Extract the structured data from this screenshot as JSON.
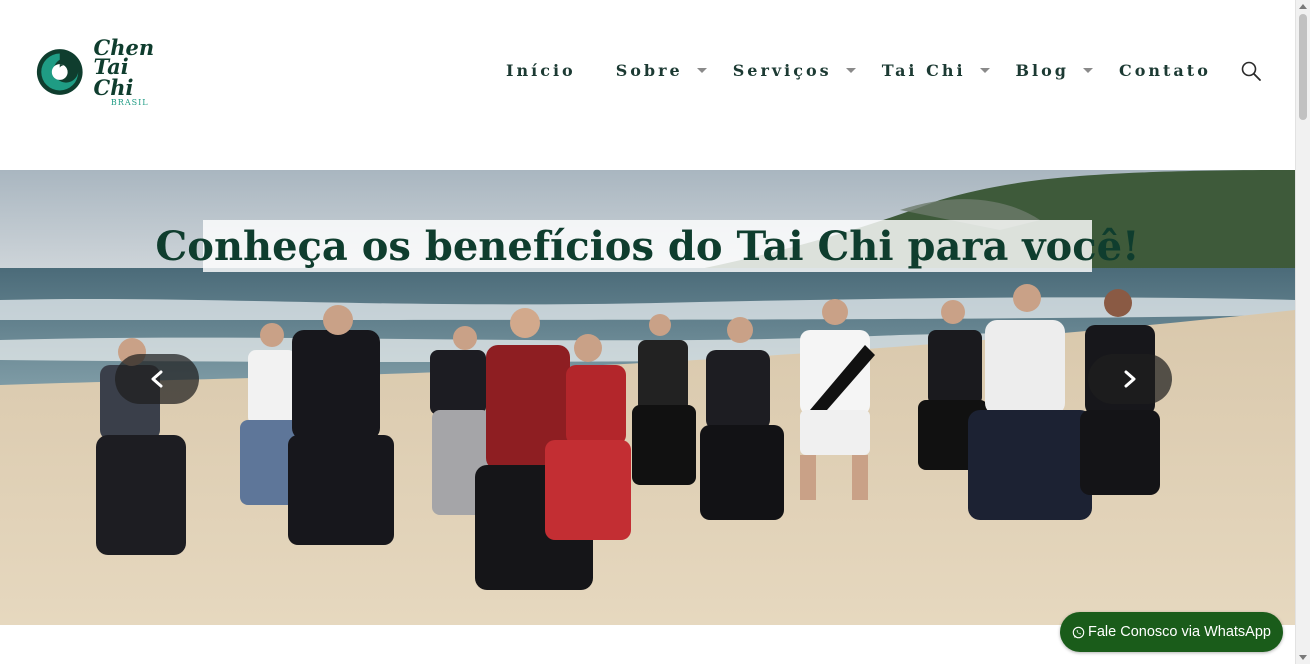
{
  "logo": {
    "line1": "Chen",
    "line2": "Tai Chi",
    "line3": "BRASIL",
    "colors": {
      "ring": "#0f3d2e",
      "inner": "#1f9c84"
    }
  },
  "nav": {
    "items": [
      {
        "label": "Início",
        "has_dropdown": false
      },
      {
        "label": "Sobre",
        "has_dropdown": true
      },
      {
        "label": "Serviços",
        "has_dropdown": true
      },
      {
        "label": "Tai Chi",
        "has_dropdown": true
      },
      {
        "label": "Blog",
        "has_dropdown": true
      },
      {
        "label": "Contato",
        "has_dropdown": false
      }
    ],
    "search_icon": "search-icon"
  },
  "hero": {
    "title": "Conheça os benefícios do Tai Chi para você!",
    "prev_icon": "chevron-left-icon",
    "next_icon": "chevron-right-icon"
  },
  "whatsapp": {
    "label": "Fale Conosco via WhatsApp",
    "icon": "whatsapp-icon",
    "color": "#1a5c1a"
  },
  "colors": {
    "brand_dark": "#0f3d2e",
    "nav_text": "#1c3a33"
  }
}
